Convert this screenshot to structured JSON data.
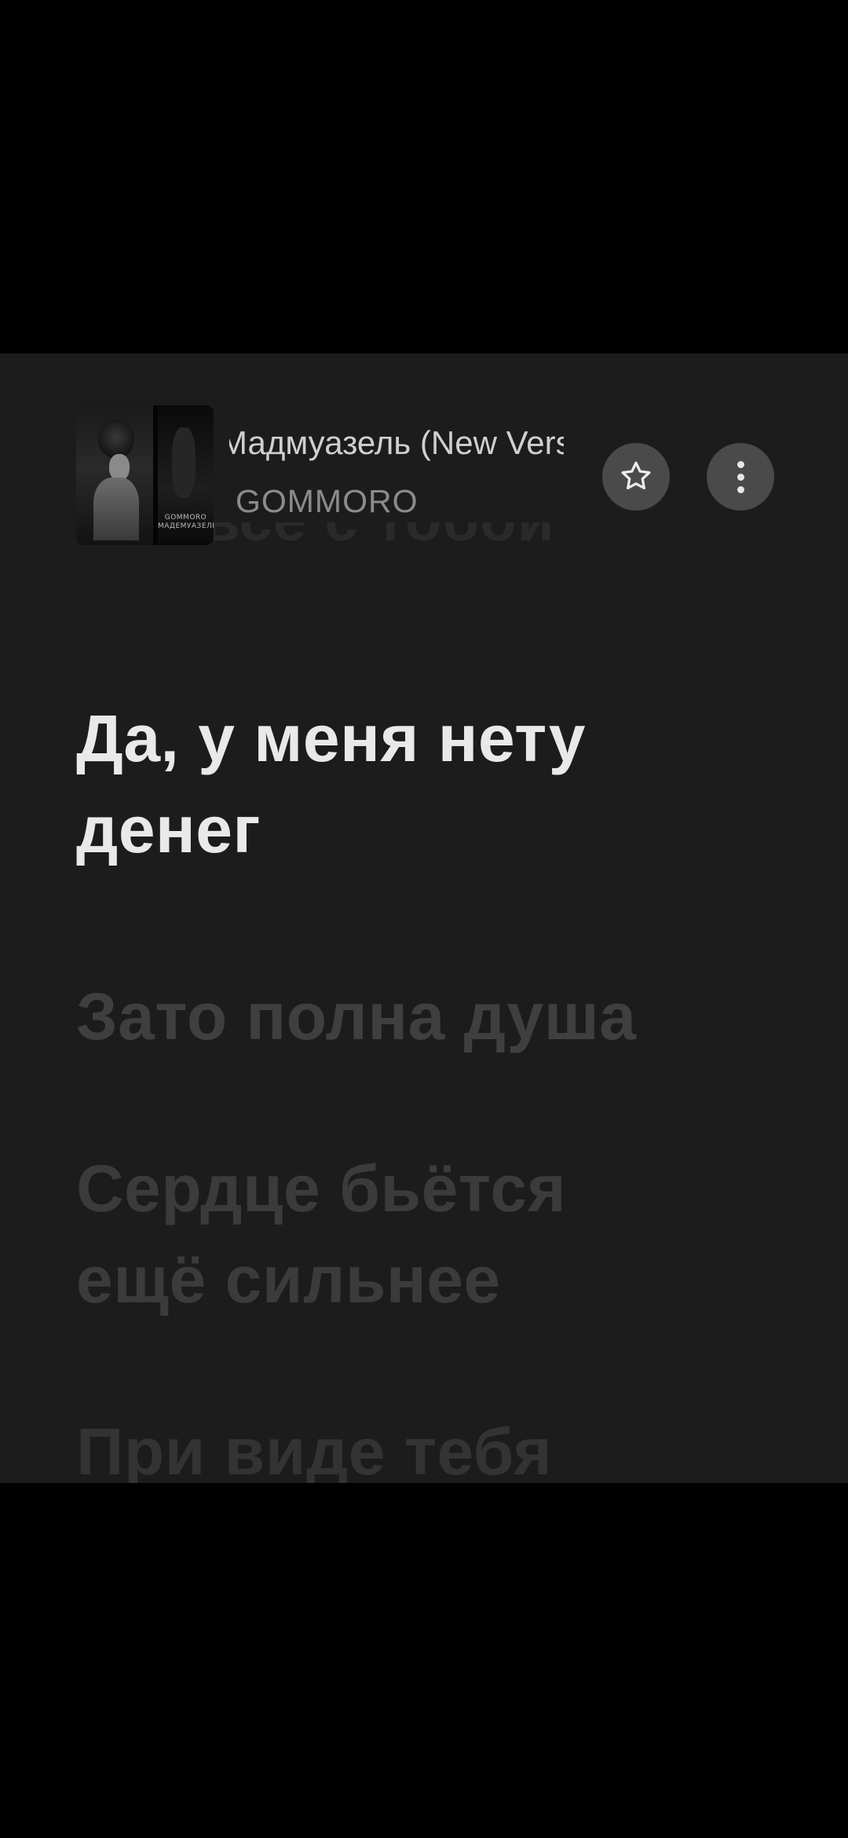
{
  "now_playing": {
    "title": "Мадмуазель (New Version)",
    "artist": "GOMMORO",
    "album_art_text": "GOMMORO МАДЕМУАЗЕЛЬ",
    "favorite_icon": "star-outline-icon",
    "more_icon": "vertical-dots-icon"
  },
  "lyrics": {
    "previous_line": "Это всё с тобой",
    "current_line": "Да, у меня нету денег",
    "next_lines": [
      "Зато полна душа",
      "Сердце бьётся ещё сильнее",
      "При виде тебя"
    ]
  },
  "colors": {
    "background": "#1c1c1c",
    "active_lyric": "#e9e9e9",
    "inactive_lyric": "#3f3f3f",
    "button_background": "#4a4a4a"
  }
}
